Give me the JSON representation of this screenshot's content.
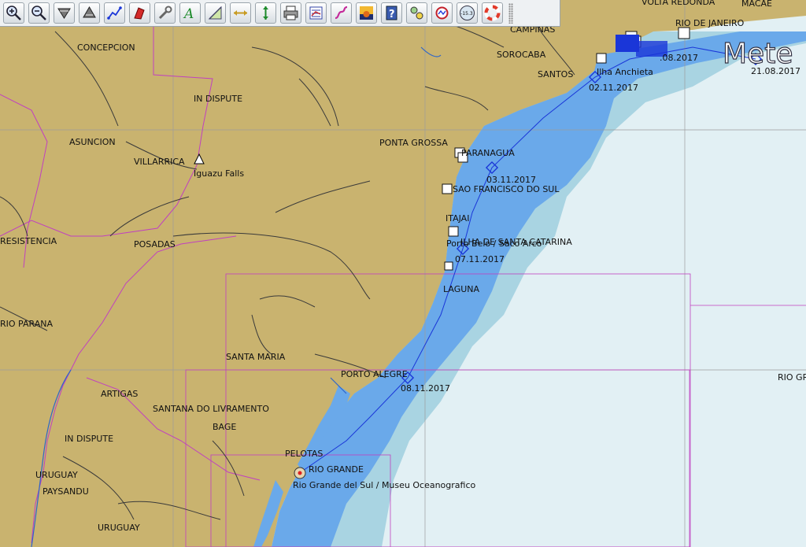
{
  "toolbar": {
    "buttons": [
      {
        "name": "zoom-in-button",
        "icon": "zoom-in-icon"
      },
      {
        "name": "zoom-out-button",
        "icon": "zoom-out-icon"
      },
      {
        "name": "chart-down-button",
        "icon": "chart-down-icon"
      },
      {
        "name": "chart-up-button",
        "icon": "chart-up-icon"
      },
      {
        "name": "route-button",
        "icon": "route-icon"
      },
      {
        "name": "follow-ship-button",
        "icon": "ship-icon"
      },
      {
        "name": "settings-button",
        "icon": "wrench-icon"
      },
      {
        "name": "text-button",
        "icon": "text-icon"
      },
      {
        "name": "measure-button",
        "icon": "measure-icon"
      },
      {
        "name": "tide-button",
        "icon": "tide-icon"
      },
      {
        "name": "current-button",
        "icon": "current-icon"
      },
      {
        "name": "print-button",
        "icon": "print-icon"
      },
      {
        "name": "route-manager-button",
        "icon": "route-manager-icon"
      },
      {
        "name": "track-button",
        "icon": "track-icon"
      },
      {
        "name": "color-scheme-button",
        "icon": "color-scheme-icon"
      },
      {
        "name": "help-button",
        "icon": "help-icon"
      },
      {
        "name": "ais-button",
        "icon": "ais-icon"
      },
      {
        "name": "weather-button",
        "icon": "weather-icon"
      },
      {
        "name": "compass-button",
        "icon": "compass-icon",
        "text": "-15.3"
      },
      {
        "name": "mob-button",
        "icon": "lifebuoy-icon"
      }
    ]
  },
  "map": {
    "places": [
      {
        "id": "concepcion",
        "text": "CONCEPCION"
      },
      {
        "id": "in-dispute-1",
        "text": "IN DISPUTE"
      },
      {
        "id": "asuncion",
        "text": "ASUNCION"
      },
      {
        "id": "villarrica",
        "text": "VILLARRICA"
      },
      {
        "id": "iguazu",
        "text": "Iguazu Falls"
      },
      {
        "id": "resistencia",
        "text": "RESISTENCIA"
      },
      {
        "id": "posadas",
        "text": "POSADAS"
      },
      {
        "id": "rio-parana",
        "text": "RIO PARANA"
      },
      {
        "id": "santa-maria",
        "text": "SANTA MARIA"
      },
      {
        "id": "artigas",
        "text": "ARTIGAS"
      },
      {
        "id": "santana",
        "text": "SANTANA DO LIVRAMENTO"
      },
      {
        "id": "bage",
        "text": "BAGE"
      },
      {
        "id": "in-dispute-2",
        "text": "IN DISPUTE"
      },
      {
        "id": "uruguay-1",
        "text": "URUGUAY"
      },
      {
        "id": "paysandu",
        "text": "PAYSANDU"
      },
      {
        "id": "uruguay-2",
        "text": "URUGUAY"
      },
      {
        "id": "campinas",
        "text": "CAMPINAS"
      },
      {
        "id": "sorocaba",
        "text": "SOROCABA"
      },
      {
        "id": "santos",
        "text": "SANTOS"
      },
      {
        "id": "ponta-grossa",
        "text": "PONTA GROSSA"
      },
      {
        "id": "paranagua",
        "text": "PARANAGUA"
      },
      {
        "id": "sao-francisco",
        "text": "SAO FRANCISCO DO SUL"
      },
      {
        "id": "itajai",
        "text": "ITAJAI"
      },
      {
        "id": "ilha-santa-catarina",
        "text": "ILHA DE SANTA CATARINA"
      },
      {
        "id": "porto-belo",
        "text": "Porto Belo / Saco Arco"
      },
      {
        "id": "laguna",
        "text": "LAGUNA"
      },
      {
        "id": "porto-alegre",
        "text": "PORTO ALEGRE"
      },
      {
        "id": "pelotas",
        "text": "PELOTAS"
      },
      {
        "id": "rio-grande",
        "text": "RIO GRANDE"
      },
      {
        "id": "museu",
        "text": "Rio Grande del Sul / Museu Oceanografico"
      },
      {
        "id": "ilha-anchieta",
        "text": "Ilha Anchieta"
      },
      {
        "id": "rio-de-janeiro",
        "text": "RIO DE JANEIRO"
      },
      {
        "id": "volta-redonda",
        "text": "VOLTA REDONDA"
      },
      {
        "id": "macae",
        "text": "MACAE"
      },
      {
        "id": "rio-grid",
        "text": "RIO GR"
      },
      {
        "id": "weather-overlay",
        "text": "Mete"
      }
    ],
    "dates": [
      {
        "id": "d-0211",
        "text": "02.11.2017"
      },
      {
        "id": "d-0311",
        "text": "03.11.2017"
      },
      {
        "id": "d-0711",
        "text": "07.11.2017"
      },
      {
        "id": "d-0811",
        "text": "08.11.2017"
      },
      {
        "id": "d-2108",
        "text": "21.08.2017"
      },
      {
        "id": "d-0808",
        "text": ".08.2017"
      }
    ],
    "colors": {
      "land": "#c9b36f",
      "deep_sea": "#e2f0f4",
      "shallow_sea": "#a9d4e2",
      "route_zone": "#6aa9ea",
      "border": "#c040c0",
      "road": "#3a3a3a",
      "track": "#1a36d8",
      "river": "#2f66c8"
    }
  }
}
